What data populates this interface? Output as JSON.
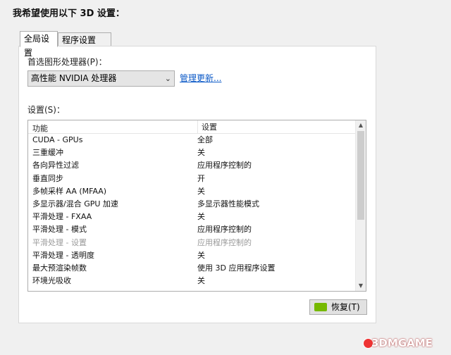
{
  "heading": "我希望使用以下 3D 设置：",
  "tabs": [
    {
      "label": "全局设置",
      "active": true
    },
    {
      "label": "程序设置",
      "active": false
    }
  ],
  "gpu": {
    "label": "首选图形处理器(P)：",
    "selected": "高性能 NVIDIA 处理器",
    "manage_link": "管理更新..."
  },
  "settings": {
    "label": "设置(S)：",
    "columns": [
      "功能",
      "设置"
    ],
    "rows": [
      {
        "feature": "CUDA - GPUs",
        "value": "全部",
        "disabled": false
      },
      {
        "feature": "三重缓冲",
        "value": "关",
        "disabled": false
      },
      {
        "feature": "各向异性过滤",
        "value": "应用程序控制的",
        "disabled": false
      },
      {
        "feature": "垂直同步",
        "value": "开",
        "disabled": false
      },
      {
        "feature": "多帧采样 AA (MFAA)",
        "value": "关",
        "disabled": false
      },
      {
        "feature": "多显示器/混合 GPU 加速",
        "value": "多显示器性能模式",
        "disabled": false
      },
      {
        "feature": "平滑处理 - FXAA",
        "value": "关",
        "disabled": false
      },
      {
        "feature": "平滑处理 - 模式",
        "value": "应用程序控制的",
        "disabled": false
      },
      {
        "feature": "平滑处理 - 设置",
        "value": "应用程序控制的",
        "disabled": true
      },
      {
        "feature": "平滑处理 - 透明度",
        "value": "关",
        "disabled": false
      },
      {
        "feature": "最大预渲染帧数",
        "value": "使用 3D 应用程序设置",
        "disabled": false
      },
      {
        "feature": "环境光吸收",
        "value": "关",
        "disabled": false
      }
    ]
  },
  "restore_button": "恢复(T)",
  "watermark": "3DMGAME",
  "colors": {
    "accent_link": "#0b59c7",
    "nvidia_green": "#76b900"
  }
}
